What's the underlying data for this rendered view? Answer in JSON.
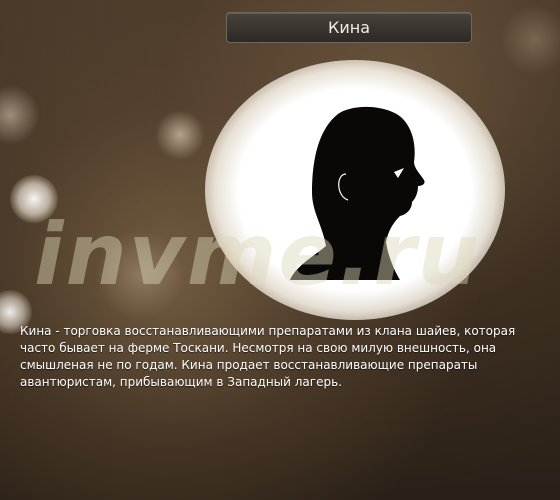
{
  "window": {
    "title": "Кина"
  },
  "portrait": {
    "icon": "person-head-silhouette-icon"
  },
  "watermark": {
    "text": "invme.ru"
  },
  "description": {
    "text": "Кина - торговка восстанавливающими препаратами из клана шайев, которая часто бывает на ферме Тоскани. Несмотря на свою милую внешность, она смышленая не по годам. Кина продает восстанавливающие препараты авантюристам, прибывающим в Западный лагерь."
  },
  "colors": {
    "background": "#3a2d20",
    "title_bar": "#2d2924",
    "glow": "#ffffff",
    "text": "#ffffff"
  }
}
